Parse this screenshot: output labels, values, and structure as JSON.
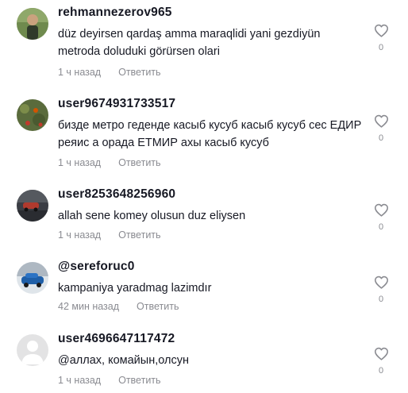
{
  "comments": [
    {
      "username": "rehmannezerov965",
      "text": "düz deyirsen qardaş amma maraqlidi yani gezdiyün metroda doluduki görürsen olari",
      "time": "1 ч назад",
      "reply_label": "Ответить",
      "likes": "0",
      "avatar": "person-photo"
    },
    {
      "username": "user9674931733517",
      "text": "бизде метро геденде касыб кусуб касыб кусуб сес ЕДИР реяис а орада ЕТМИР ахы касыб кусуб",
      "time": "1 ч назад",
      "reply_label": "Ответить",
      "likes": "0",
      "avatar": "flowers-photo"
    },
    {
      "username": "user8253648256960",
      "text": "allah sene komey olusun duz eliysen",
      "time": "1 ч назад",
      "reply_label": "Ответить",
      "likes": "0",
      "avatar": "car-road-photo"
    },
    {
      "username": "@sereforuc0",
      "text": "kampaniya yaradmag lazimdır",
      "time": "42 мин назад",
      "reply_label": "Ответить",
      "likes": "0",
      "avatar": "blue-car-photo"
    },
    {
      "username": "user4696647117472",
      "text": "@аллах, комайын,олсун",
      "time": "1 ч назад",
      "reply_label": "Ответить",
      "likes": "0",
      "avatar": "default-avatar"
    }
  ],
  "colors": {
    "text": "#161823",
    "meta": "#8a8b91",
    "heart_outline": "#8a8b91"
  },
  "icons": {
    "like": "heart-outline-icon"
  }
}
